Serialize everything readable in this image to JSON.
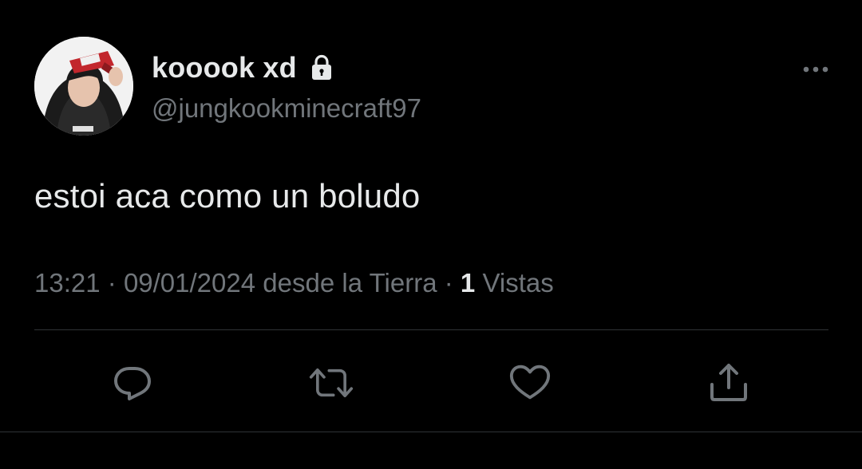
{
  "tweet": {
    "display_name": "kooook xd",
    "handle": "@jungkookminecraft97",
    "text": "estoi aca como un boludo",
    "time": "13:21",
    "separator": "·",
    "date": "09/01/2024",
    "source": "desde la Tierra",
    "views_count": "1",
    "views_label": "Vistas",
    "protected": true
  },
  "icons": {
    "lock": "lock-icon",
    "more": "more-horizontal-icon",
    "reply": "reply-icon",
    "retweet": "retweet-icon",
    "like": "heart-icon",
    "share": "share-icon"
  },
  "colors": {
    "background": "#000000",
    "primary_text": "#e7e9ea",
    "secondary_text": "#71767b",
    "divider": "#2f3336",
    "action_icon": "#71767b"
  }
}
